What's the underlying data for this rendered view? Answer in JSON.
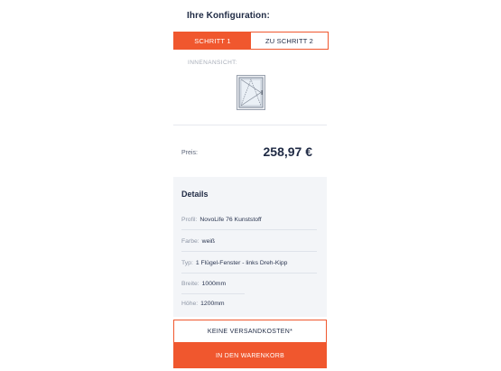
{
  "configuration": {
    "title": "Ihre Konfiguration:"
  },
  "tabs": [
    {
      "label": "SCHRITT 1",
      "active": true
    },
    {
      "label": "ZU SCHRITT 2",
      "active": false
    }
  ],
  "view": {
    "label": "INNENANSICHT:",
    "icon": "window-tilt-turn-icon"
  },
  "price": {
    "label": "Preis:",
    "value": "258,97 €"
  },
  "details": {
    "title": "Details",
    "rows": [
      {
        "key": "Profil:",
        "value": "NovoLife 76 Kunststoff"
      },
      {
        "key": "Farbe:",
        "value": "weiß"
      },
      {
        "key": "Typ:",
        "value": "1 Flügel-Fenster - links Dreh-Kipp"
      },
      {
        "key": "Breite:",
        "value": "1000mm"
      },
      {
        "key": "Höhe:",
        "value": "1200mm"
      }
    ]
  },
  "buttons": {
    "shipping_label": "KEINE VERSANDKOSTEN*",
    "cart_label": "IN DEN WARENKORB"
  },
  "colors": {
    "accent": "#f0572e",
    "text": "#1f2a44",
    "details_bg": "#f3f5f8"
  }
}
